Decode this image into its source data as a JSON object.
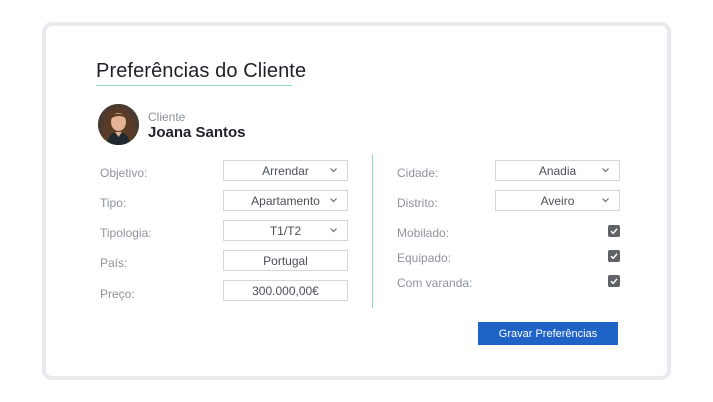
{
  "page": {
    "title": "Preferências do Cliente"
  },
  "client": {
    "label": "Cliente",
    "name": "Joana Santos"
  },
  "left_fields": {
    "objetivo": {
      "label": "Objetivo:",
      "value": "Arrendar",
      "icon": "chevron-down-icon"
    },
    "tipo": {
      "label": "Tipo:",
      "value": "Apartamento",
      "icon": "chevron-down-icon"
    },
    "tipologia": {
      "label": "Tipologia:",
      "value": "T1/T2",
      "icon": "chevron-down-icon"
    },
    "pais": {
      "label": "País:",
      "value": "Portugal"
    },
    "preco": {
      "label": "Preço:",
      "value": "300.000,00€"
    }
  },
  "right_fields": {
    "cidade": {
      "label": "Cidade:",
      "value": "Anadia",
      "icon": "chevron-down-icon"
    },
    "distrito": {
      "label": "Distrito:",
      "value": "Aveiro",
      "icon": "chevron-down-icon"
    },
    "mobilado": {
      "label": "Mobilado:",
      "checked": true
    },
    "equipado": {
      "label": "Equipado:",
      "checked": true
    },
    "varanda": {
      "label": "Com varanda:",
      "checked": true
    }
  },
  "actions": {
    "save_label": "Gravar Preferências"
  },
  "colors": {
    "accent": "#1f63c6",
    "divider": "#8fd6d3",
    "checkbox": "#5f6368"
  }
}
